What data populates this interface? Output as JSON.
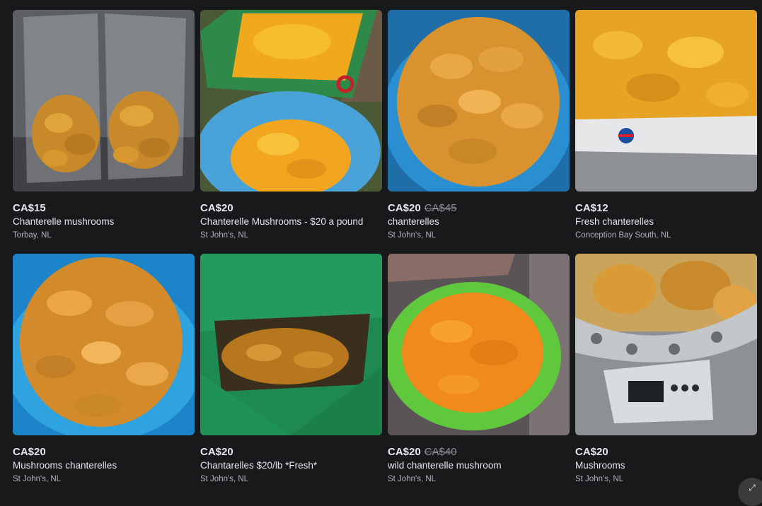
{
  "listings": [
    {
      "price": "CA$15",
      "old_price": "",
      "title": "Chanterelle mushrooms",
      "location": "Torbay, NL",
      "photo": "mushrooms-in-plastic-bags"
    },
    {
      "price": "CA$20",
      "old_price": "",
      "title": "Chanterelle Mushrooms - $20 a pound",
      "location": "St John's, NL",
      "photo": "mushrooms-in-crate-and-blue-basket"
    },
    {
      "price": "CA$20",
      "old_price": "CA$45",
      "title": "chanterelles",
      "location": "St John's, NL",
      "photo": "mushrooms-heaped-in-blue-basket"
    },
    {
      "price": "CA$12",
      "old_price": "",
      "title": "Fresh chanterelles",
      "location": "Conception Bay South, NL",
      "photo": "mushrooms-in-cardboard-box"
    },
    {
      "price": "CA$20",
      "old_price": "",
      "title": "Mushrooms chanterelles",
      "location": "St John's, NL",
      "photo": "mushrooms-in-blue-basket"
    },
    {
      "price": "CA$20",
      "old_price": "",
      "title": "Chantarelles $20/lb *Fresh*",
      "location": "St John's, NL",
      "photo": "mushrooms-in-green-bag"
    },
    {
      "price": "CA$20",
      "old_price": "CA$40",
      "title": "wild chanterelle mushroom",
      "location": "St John's, NL",
      "photo": "mushrooms-on-green-tray"
    },
    {
      "price": "CA$20",
      "old_price": "",
      "title": "Mushrooms",
      "location": "St John's, NL",
      "photo": "mushrooms-on-kitchen-scale"
    }
  ]
}
